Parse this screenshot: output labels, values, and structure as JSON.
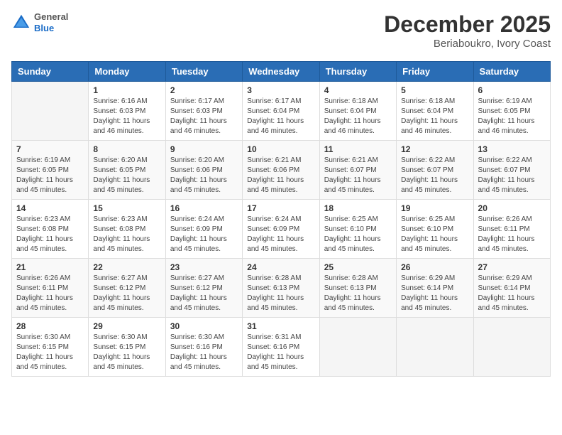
{
  "header": {
    "logo": {
      "general": "General",
      "blue": "Blue"
    },
    "title": "December 2025",
    "subtitle": "Beriaboukro, Ivory Coast"
  },
  "calendar": {
    "days_of_week": [
      "Sunday",
      "Monday",
      "Tuesday",
      "Wednesday",
      "Thursday",
      "Friday",
      "Saturday"
    ],
    "weeks": [
      [
        {
          "day": "",
          "info": ""
        },
        {
          "day": "1",
          "info": "Sunrise: 6:16 AM\nSunset: 6:03 PM\nDaylight: 11 hours\nand 46 minutes."
        },
        {
          "day": "2",
          "info": "Sunrise: 6:17 AM\nSunset: 6:03 PM\nDaylight: 11 hours\nand 46 minutes."
        },
        {
          "day": "3",
          "info": "Sunrise: 6:17 AM\nSunset: 6:04 PM\nDaylight: 11 hours\nand 46 minutes."
        },
        {
          "day": "4",
          "info": "Sunrise: 6:18 AM\nSunset: 6:04 PM\nDaylight: 11 hours\nand 46 minutes."
        },
        {
          "day": "5",
          "info": "Sunrise: 6:18 AM\nSunset: 6:04 PM\nDaylight: 11 hours\nand 46 minutes."
        },
        {
          "day": "6",
          "info": "Sunrise: 6:19 AM\nSunset: 6:05 PM\nDaylight: 11 hours\nand 46 minutes."
        }
      ],
      [
        {
          "day": "7",
          "info": "Sunrise: 6:19 AM\nSunset: 6:05 PM\nDaylight: 11 hours\nand 45 minutes."
        },
        {
          "day": "8",
          "info": "Sunrise: 6:20 AM\nSunset: 6:05 PM\nDaylight: 11 hours\nand 45 minutes."
        },
        {
          "day": "9",
          "info": "Sunrise: 6:20 AM\nSunset: 6:06 PM\nDaylight: 11 hours\nand 45 minutes."
        },
        {
          "day": "10",
          "info": "Sunrise: 6:21 AM\nSunset: 6:06 PM\nDaylight: 11 hours\nand 45 minutes."
        },
        {
          "day": "11",
          "info": "Sunrise: 6:21 AM\nSunset: 6:07 PM\nDaylight: 11 hours\nand 45 minutes."
        },
        {
          "day": "12",
          "info": "Sunrise: 6:22 AM\nSunset: 6:07 PM\nDaylight: 11 hours\nand 45 minutes."
        },
        {
          "day": "13",
          "info": "Sunrise: 6:22 AM\nSunset: 6:07 PM\nDaylight: 11 hours\nand 45 minutes."
        }
      ],
      [
        {
          "day": "14",
          "info": "Sunrise: 6:23 AM\nSunset: 6:08 PM\nDaylight: 11 hours\nand 45 minutes."
        },
        {
          "day": "15",
          "info": "Sunrise: 6:23 AM\nSunset: 6:08 PM\nDaylight: 11 hours\nand 45 minutes."
        },
        {
          "day": "16",
          "info": "Sunrise: 6:24 AM\nSunset: 6:09 PM\nDaylight: 11 hours\nand 45 minutes."
        },
        {
          "day": "17",
          "info": "Sunrise: 6:24 AM\nSunset: 6:09 PM\nDaylight: 11 hours\nand 45 minutes."
        },
        {
          "day": "18",
          "info": "Sunrise: 6:25 AM\nSunset: 6:10 PM\nDaylight: 11 hours\nand 45 minutes."
        },
        {
          "day": "19",
          "info": "Sunrise: 6:25 AM\nSunset: 6:10 PM\nDaylight: 11 hours\nand 45 minutes."
        },
        {
          "day": "20",
          "info": "Sunrise: 6:26 AM\nSunset: 6:11 PM\nDaylight: 11 hours\nand 45 minutes."
        }
      ],
      [
        {
          "day": "21",
          "info": "Sunrise: 6:26 AM\nSunset: 6:11 PM\nDaylight: 11 hours\nand 45 minutes."
        },
        {
          "day": "22",
          "info": "Sunrise: 6:27 AM\nSunset: 6:12 PM\nDaylight: 11 hours\nand 45 minutes."
        },
        {
          "day": "23",
          "info": "Sunrise: 6:27 AM\nSunset: 6:12 PM\nDaylight: 11 hours\nand 45 minutes."
        },
        {
          "day": "24",
          "info": "Sunrise: 6:28 AM\nSunset: 6:13 PM\nDaylight: 11 hours\nand 45 minutes."
        },
        {
          "day": "25",
          "info": "Sunrise: 6:28 AM\nSunset: 6:13 PM\nDaylight: 11 hours\nand 45 minutes."
        },
        {
          "day": "26",
          "info": "Sunrise: 6:29 AM\nSunset: 6:14 PM\nDaylight: 11 hours\nand 45 minutes."
        },
        {
          "day": "27",
          "info": "Sunrise: 6:29 AM\nSunset: 6:14 PM\nDaylight: 11 hours\nand 45 minutes."
        }
      ],
      [
        {
          "day": "28",
          "info": "Sunrise: 6:30 AM\nSunset: 6:15 PM\nDaylight: 11 hours\nand 45 minutes."
        },
        {
          "day": "29",
          "info": "Sunrise: 6:30 AM\nSunset: 6:15 PM\nDaylight: 11 hours\nand 45 minutes."
        },
        {
          "day": "30",
          "info": "Sunrise: 6:30 AM\nSunset: 6:16 PM\nDaylight: 11 hours\nand 45 minutes."
        },
        {
          "day": "31",
          "info": "Sunrise: 6:31 AM\nSunset: 6:16 PM\nDaylight: 11 hours\nand 45 minutes."
        },
        {
          "day": "",
          "info": ""
        },
        {
          "day": "",
          "info": ""
        },
        {
          "day": "",
          "info": ""
        }
      ]
    ]
  }
}
